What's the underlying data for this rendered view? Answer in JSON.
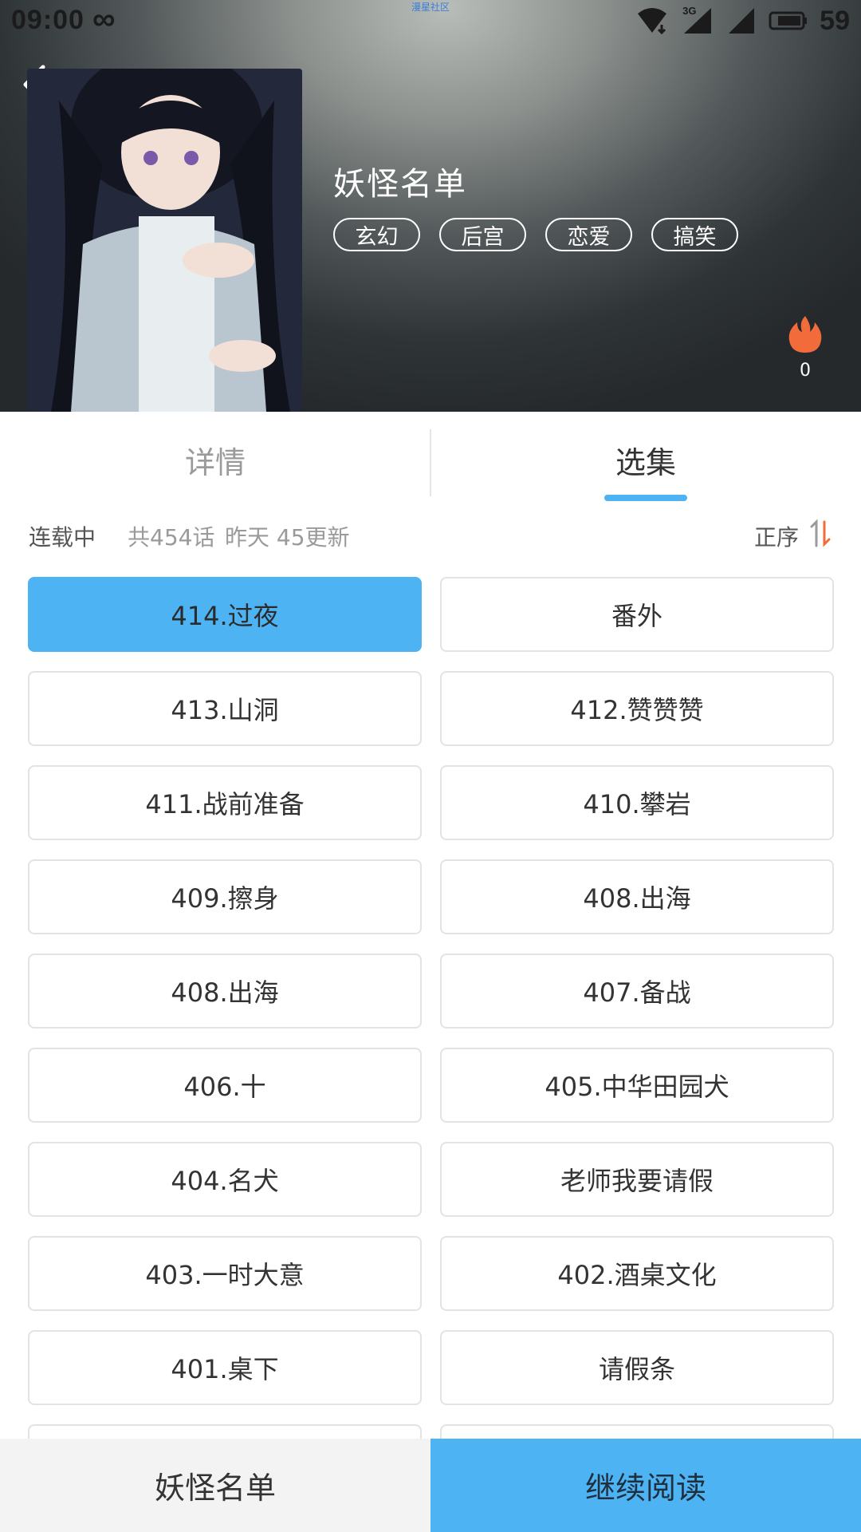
{
  "status_bar": {
    "time": "09:00",
    "loop_symbol": "∞",
    "center_text": "漫星社区",
    "network_label": "3G",
    "battery": "59"
  },
  "comic": {
    "title": "妖怪名单",
    "cover_text": "妖怪名单",
    "tags": [
      "玄幻",
      "后宫",
      "恋爱",
      "搞笑"
    ],
    "heat_count": "0"
  },
  "tabs": {
    "details": "详情",
    "episodes": "选集",
    "active": "episodes"
  },
  "info": {
    "status": "连载中",
    "count": "共454话",
    "update": "昨天 45更新",
    "sort_label": "正序"
  },
  "episodes": [
    {
      "label": "414.过夜",
      "active": true
    },
    {
      "label": "番外",
      "active": false
    },
    {
      "label": "413.山洞",
      "active": false
    },
    {
      "label": "412.赞赞赞",
      "active": false
    },
    {
      "label": "411.战前准备",
      "active": false
    },
    {
      "label": "410.攀岩",
      "active": false
    },
    {
      "label": "409.擦身",
      "active": false
    },
    {
      "label": "408.出海",
      "active": false
    },
    {
      "label": "408.出海",
      "active": false
    },
    {
      "label": "407.备战",
      "active": false
    },
    {
      "label": "406.十",
      "active": false
    },
    {
      "label": "405.中华田园犬",
      "active": false
    },
    {
      "label": "404.名犬",
      "active": false
    },
    {
      "label": "老师我要请假",
      "active": false
    },
    {
      "label": "403.一时大意",
      "active": false
    },
    {
      "label": "402.酒桌文化",
      "active": false
    },
    {
      "label": "401.桌下",
      "active": false
    },
    {
      "label": "请假条",
      "active": false
    },
    {
      "label": "",
      "active": false
    },
    {
      "label": "",
      "active": false
    }
  ],
  "bottom_bar": {
    "title": "妖怪名单",
    "continue": "继续阅读"
  },
  "colors": {
    "accent": "#4db3f3",
    "heat": "#f26b3a"
  }
}
